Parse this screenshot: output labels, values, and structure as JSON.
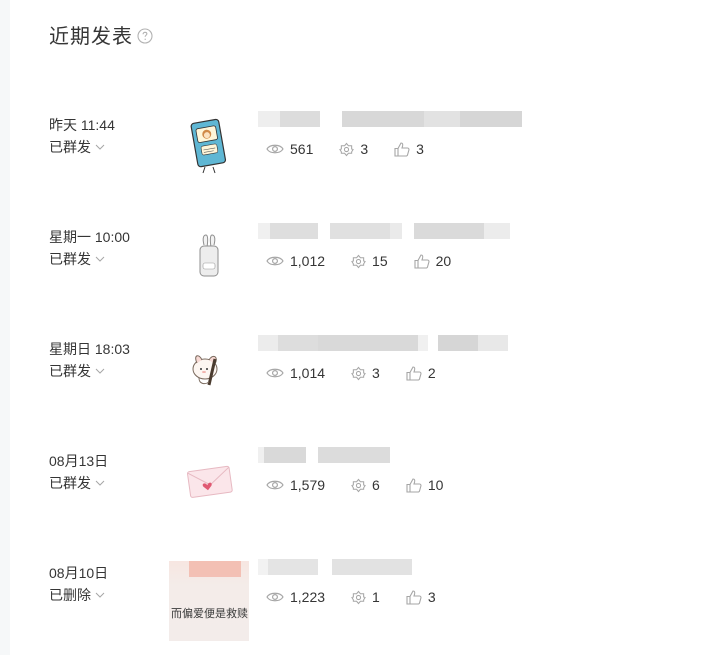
{
  "header": {
    "title": "近期发表",
    "help_icon": "question-circle-icon"
  },
  "posts": [
    {
      "time": "昨天 11:44",
      "status": "已群发",
      "views": "561",
      "shares": "3",
      "likes": "3",
      "thumb": "book-character-sticker"
    },
    {
      "time": "星期一 10:00",
      "status": "已群发",
      "views": "1,012",
      "shares": "15",
      "likes": "20",
      "thumb": "rabbit-phone-sticker"
    },
    {
      "time": "星期日 18:03",
      "status": "已群发",
      "views": "1,014",
      "shares": "3",
      "likes": "2",
      "thumb": "bunny-pen-sticker"
    },
    {
      "time": "08月13日",
      "status": "已群发",
      "views": "1,579",
      "shares": "6",
      "likes": "10",
      "thumb": "envelope-heart-sticker"
    },
    {
      "time": "08月10日",
      "status": "已删除",
      "views": "1,223",
      "shares": "1",
      "likes": "3",
      "thumb": "handwriting-photo",
      "thumb_text": "而偏爱便是救赎"
    }
  ],
  "colors": {
    "text": "#353535",
    "icon": "#a6a6a6",
    "blur": "#e4e4e4",
    "rail": "#f6f8f9"
  }
}
